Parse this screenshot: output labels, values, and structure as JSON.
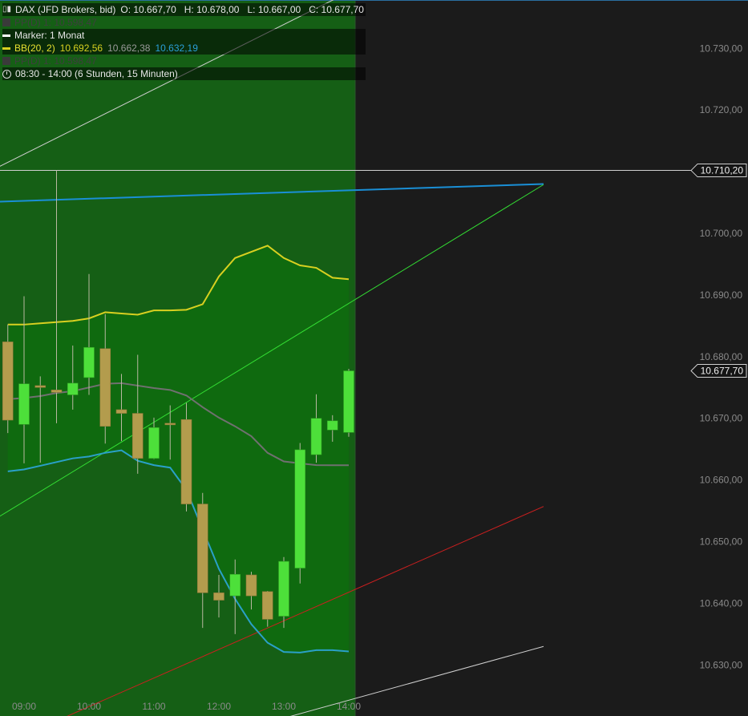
{
  "header": {
    "symbol_icon": "candlestick-icon",
    "title": "DAX (JFD Brokers, bid)",
    "ohlc": "O: 10.667,70   H: 10.678,00   L: 10.667,00   C: 10.677,70"
  },
  "legend": {
    "pp1": "PP(D)  1: 10.598,47",
    "marker": "Marker: 1 Monat",
    "bb_label": "BB(20, 2)",
    "bb_upper": "10.692,56",
    "bb_mid": "10.662,38",
    "bb_lower": "10.632,19",
    "pp2": "PP(D)  1: 10.598,47",
    "session": "08:30 - 14:00 (6 Stunden, 15 Minuten)"
  },
  "colors": {
    "background": "#1b1b1b",
    "session_fill": "#155f15",
    "session_inner": "#0f6a0f",
    "bull": "#4de03a",
    "bear": "#b39c4d",
    "bb_upper": "#d8d020",
    "bb_mid": "#707070",
    "bb_lower": "#2aa0c8",
    "trend_blue": "#1a8fd6",
    "trend_green": "#33dd33",
    "trend_red": "#cc1f1f",
    "trend_white": "#cfcfcf",
    "axis_text": "#8a8a8a"
  },
  "chart_data": {
    "type": "candlestick",
    "ylim": [
      10625.5,
      10741.5
    ],
    "y_ticks": [
      {
        "value": 10730,
        "label": "10.730,00"
      },
      {
        "value": 10720,
        "label": "10.720,00"
      },
      {
        "value": 10710,
        "label": "10.710,00"
      },
      {
        "value": 10700,
        "label": "10.700,00"
      },
      {
        "value": 10690,
        "label": "10.690,00"
      },
      {
        "value": 10680,
        "label": "10.680,00"
      },
      {
        "value": 10670,
        "label": "10.670,00"
      },
      {
        "value": 10660,
        "label": "10.660,00"
      },
      {
        "value": 10650,
        "label": "10.650,00"
      },
      {
        "value": 10640,
        "label": "10.640,00"
      },
      {
        "value": 10630,
        "label": "10.630,00"
      }
    ],
    "x_ticks": [
      "09:00",
      "10:00",
      "11:00",
      "12:00",
      "13:00",
      "14:00"
    ],
    "price_tags": [
      {
        "value": 10710.2,
        "label": "10.710,20"
      },
      {
        "value": 10677.7,
        "label": "10.677,70"
      }
    ],
    "candles": [
      {
        "time": "08:45",
        "o": 10682.4,
        "h": 10685.2,
        "l": 10667.6,
        "c": 10669.7
      },
      {
        "time": "09:00",
        "o": 10669.0,
        "h": 10689.8,
        "l": 10662.7,
        "c": 10675.6
      },
      {
        "time": "09:15",
        "o": 10675.3,
        "h": 10676.8,
        "l": 10662.8,
        "c": 10675.0
      },
      {
        "time": "09:30",
        "o": 10674.6,
        "h": 10710.2,
        "l": 10669.2,
        "c": 10674.2
      },
      {
        "time": "09:45",
        "o": 10673.8,
        "h": 10681.8,
        "l": 10671.4,
        "c": 10675.7
      },
      {
        "time": "10:00",
        "o": 10676.6,
        "h": 10693.4,
        "l": 10673.8,
        "c": 10681.5
      },
      {
        "time": "10:15",
        "o": 10681.3,
        "h": 10686.9,
        "l": 10665.9,
        "c": 10668.7
      },
      {
        "time": "10:30",
        "o": 10671.4,
        "h": 10677.2,
        "l": 10666.3,
        "c": 10670.8
      },
      {
        "time": "10:45",
        "o": 10670.8,
        "h": 10680.3,
        "l": 10661.0,
        "c": 10663.5
      },
      {
        "time": "11:00",
        "o": 10663.5,
        "h": 10670.1,
        "l": 10663.4,
        "c": 10668.5
      },
      {
        "time": "11:15",
        "o": 10669.2,
        "h": 10672.1,
        "l": 10663.3,
        "c": 10669.0
      },
      {
        "time": "11:30",
        "o": 10669.8,
        "h": 10672.5,
        "l": 10654.9,
        "c": 10656.1
      },
      {
        "time": "11:45",
        "o": 10656.1,
        "h": 10657.9,
        "l": 10636.0,
        "c": 10641.7
      },
      {
        "time": "12:00",
        "o": 10641.7,
        "h": 10644.6,
        "l": 10637.7,
        "c": 10640.5
      },
      {
        "time": "12:15",
        "o": 10641.2,
        "h": 10647.1,
        "l": 10635.0,
        "c": 10644.7
      },
      {
        "time": "12:30",
        "o": 10644.6,
        "h": 10645.1,
        "l": 10639.0,
        "c": 10641.2
      },
      {
        "time": "12:45",
        "o": 10641.9,
        "h": 10642.0,
        "l": 10636.2,
        "c": 10637.4
      },
      {
        "time": "13:00",
        "o": 10637.9,
        "h": 10647.5,
        "l": 10636.0,
        "c": 10646.8
      },
      {
        "time": "13:15",
        "o": 10645.7,
        "h": 10666.0,
        "l": 10643.2,
        "c": 10664.9
      },
      {
        "time": "13:30",
        "o": 10664.1,
        "h": 10673.9,
        "l": 10662.8,
        "c": 10670.0
      },
      {
        "time": "13:45",
        "o": 10668.1,
        "h": 10670.5,
        "l": 10666.2,
        "c": 10669.6
      },
      {
        "time": "14:00",
        "o": 10667.7,
        "h": 10678.0,
        "l": 10667.0,
        "c": 10677.7
      }
    ],
    "series": [
      {
        "name": "BB(20, 2)",
        "role": "upper",
        "values": [
          10685.2,
          10685.2,
          10685.4,
          10685.6,
          10685.8,
          10686.2,
          10687.2,
          10687.0,
          10686.8,
          10687.5,
          10687.5,
          10687.6,
          10688.5,
          10693.0,
          10696.0,
          10697.0,
          10698.0,
          10696.0,
          10694.8,
          10694.4,
          10692.8,
          10692.56
        ]
      },
      {
        "name": "BB(20, 2)",
        "role": "middle",
        "values": [
          10673.1,
          10673.3,
          10673.6,
          10674.1,
          10674.4,
          10675.0,
          10675.6,
          10675.7,
          10675.3,
          10674.9,
          10674.6,
          10673.7,
          10671.8,
          10670.1,
          10668.7,
          10667.1,
          10664.4,
          10663.0,
          10662.7,
          10662.4,
          10662.38,
          10662.38
        ]
      },
      {
        "name": "BB(20, 2)",
        "role": "lower",
        "values": [
          10661.4,
          10661.7,
          10662.3,
          10662.9,
          10663.5,
          10663.8,
          10664.4,
          10664.8,
          10663.1,
          10662.4,
          10662.0,
          10658.4,
          10652.0,
          10645.6,
          10640.7,
          10636.6,
          10633.6,
          10632.1,
          10632.0,
          10632.4,
          10632.4,
          10632.19
        ]
      }
    ],
    "trendlines": [
      {
        "color_key": "trend_blue",
        "x": [
          "08:30",
          "17:00"
        ],
        "y": [
          10705.1,
          10708.0
        ]
      },
      {
        "color_key": "trend_green",
        "x": [
          "08:30",
          "17:00"
        ],
        "y": [
          10653.3,
          10707.9
        ]
      },
      {
        "color_key": "trend_red",
        "x": [
          "09:00",
          "17:00"
        ],
        "y": [
          10618.6,
          10655.7
        ]
      },
      {
        "color_key": "trend_white",
        "x": [
          "08:30",
          "17:00"
        ],
        "y": [
          10710.2,
          10754.9
        ]
      },
      {
        "color_key": "trend_white",
        "x": [
          "11:30",
          "17:00"
        ],
        "y": [
          10617.0,
          10633.0
        ]
      }
    ],
    "horizontal_lines": [
      {
        "value": 10710.2,
        "color_key": "trend_white"
      }
    ]
  }
}
